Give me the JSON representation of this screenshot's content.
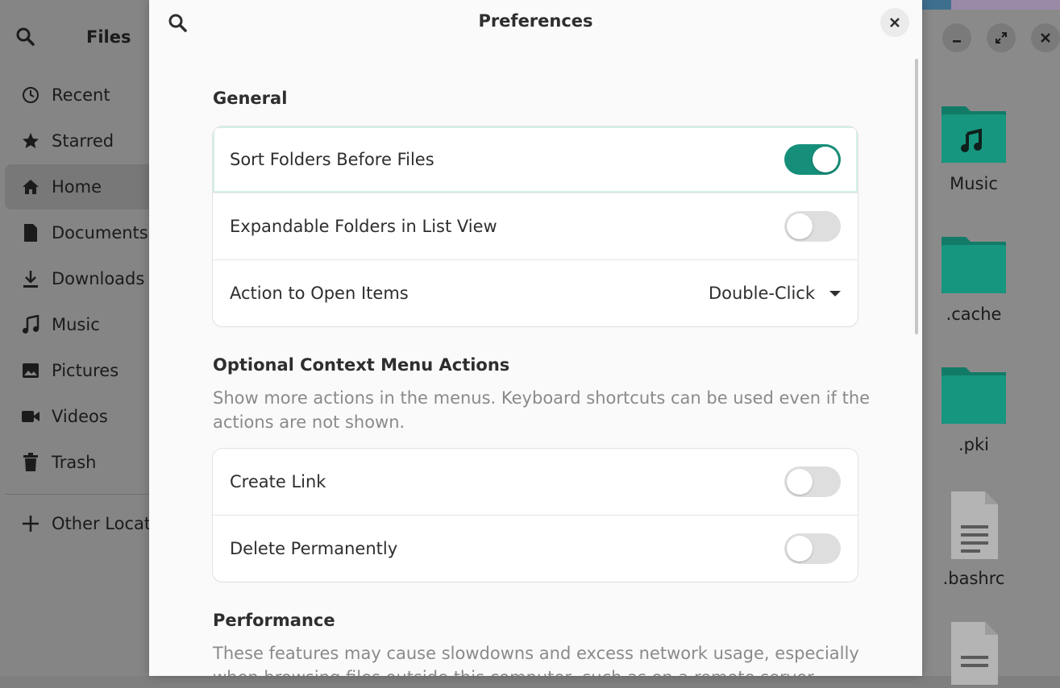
{
  "files_window": {
    "title": "Files",
    "sidebar": [
      {
        "label": "Recent",
        "icon": "clock-icon"
      },
      {
        "label": "Starred",
        "icon": "star-icon"
      },
      {
        "label": "Home",
        "icon": "home-icon",
        "active": true
      },
      {
        "label": "Documents",
        "icon": "document-icon"
      },
      {
        "label": "Downloads",
        "icon": "download-icon"
      },
      {
        "label": "Music",
        "icon": "music-icon"
      },
      {
        "label": "Pictures",
        "icon": "picture-icon"
      },
      {
        "label": "Videos",
        "icon": "video-icon"
      },
      {
        "label": "Trash",
        "icon": "trash-icon"
      }
    ],
    "other_locations": "Other Locat",
    "files": [
      {
        "name": "Music",
        "type": "music-folder"
      },
      {
        "name": ".cache",
        "type": "folder"
      },
      {
        "name": ".pki",
        "type": "folder"
      },
      {
        "name": ".bashrc",
        "type": "text-file"
      }
    ]
  },
  "preferences": {
    "title": "Preferences",
    "general": {
      "title": "General",
      "sort_folders": {
        "label": "Sort Folders Before Files",
        "enabled": true
      },
      "expandable_folders": {
        "label": "Expandable Folders in List View",
        "enabled": false
      },
      "action_open": {
        "label": "Action to Open Items",
        "value": "Double-Click"
      }
    },
    "context_menu": {
      "title": "Optional Context Menu Actions",
      "description": "Show more actions in the menus. Keyboard shortcuts can be used even if the actions are not shown.",
      "create_link": {
        "label": "Create Link",
        "enabled": false
      },
      "delete_permanently": {
        "label": "Delete Permanently",
        "enabled": false
      }
    },
    "performance": {
      "title": "Performance",
      "description": "These features may cause slowdowns and excess network usage, especially when browsing files outside this computer, such as on a remote server."
    }
  },
  "colors": {
    "accent": "#168f7a",
    "folder": "#127b68"
  }
}
